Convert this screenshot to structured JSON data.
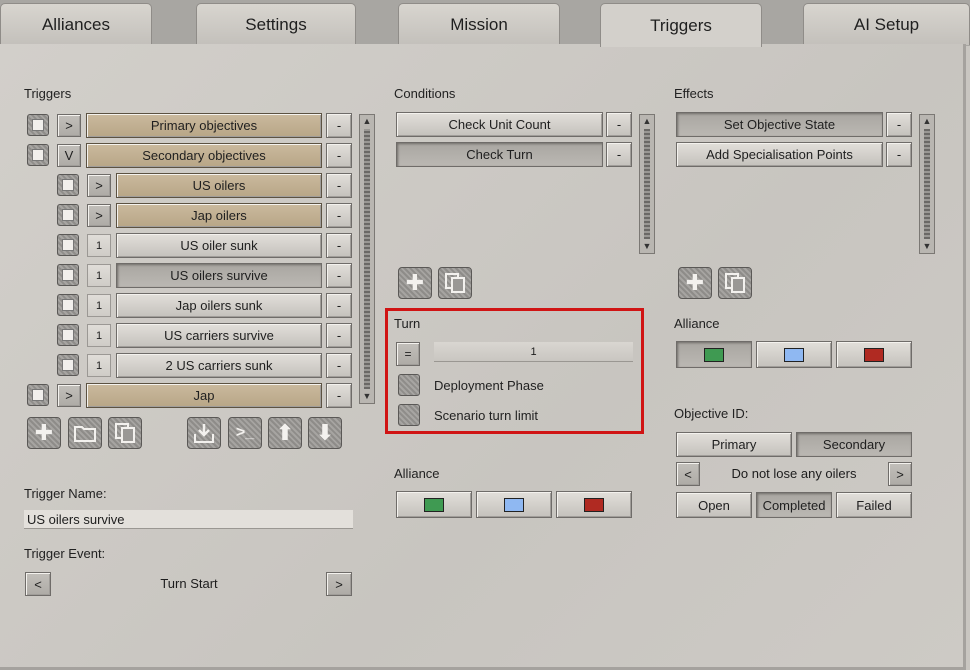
{
  "tabs": [
    {
      "label": "Alliances",
      "active": false
    },
    {
      "label": "Settings",
      "active": false
    },
    {
      "label": "Mission",
      "active": false
    },
    {
      "label": "Triggers",
      "active": true
    },
    {
      "label": "AI Setup",
      "active": false
    }
  ],
  "triggers": {
    "header": "Triggers",
    "items": [
      {
        "toggle": ">",
        "label": "Primary objectives",
        "style": "tan",
        "indent": 0
      },
      {
        "toggle": "V",
        "label": "Secondary objectives",
        "style": "tan",
        "indent": 0
      },
      {
        "toggle": ">",
        "label": "US oilers",
        "style": "tan",
        "indent": 1
      },
      {
        "toggle": ">",
        "label": "Jap oilers",
        "style": "tan",
        "indent": 1
      },
      {
        "toggle": "1",
        "label": "US oiler sunk",
        "style": "grey",
        "indent": 1
      },
      {
        "toggle": "1",
        "label": "US oilers survive",
        "style": "selected",
        "indent": 1
      },
      {
        "toggle": "1",
        "label": "Jap oilers sunk",
        "style": "grey",
        "indent": 1
      },
      {
        "toggle": "1",
        "label": "US carriers survive",
        "style": "grey",
        "indent": 1
      },
      {
        "toggle": "1",
        "label": "2 US carriers sunk",
        "style": "grey",
        "indent": 1
      },
      {
        "toggle": ">",
        "label": "Jap",
        "style": "tan",
        "indent": 0
      }
    ],
    "remove_label": "-",
    "toolbar": [
      "add-icon",
      "folder-icon",
      "copy-icon",
      "import-icon",
      "console-icon",
      "arrow-up-icon",
      "arrow-down-icon"
    ],
    "name_label": "Trigger Name:",
    "name_value": "US oilers survive",
    "event_label": "Trigger Event:",
    "event_value": "Turn Start",
    "prev": "<",
    "next": ">"
  },
  "conditions": {
    "header": "Conditions",
    "items": [
      "Check Unit Count",
      "Check Turn"
    ],
    "remove_label": "-",
    "turn": {
      "header": "Turn",
      "operator": "=",
      "value": "1",
      "options": [
        "Deployment Phase",
        "Scenario turn limit"
      ]
    },
    "alliance_label": "Alliance"
  },
  "effects": {
    "header": "Effects",
    "items": [
      "Set Objective State",
      "Add Specialisation Points"
    ],
    "remove_label": "-",
    "alliance_label": "Alliance",
    "objective_label": "Objective ID:",
    "objective_types": [
      "Primary",
      "Secondary"
    ],
    "objective_value": "Do not lose any oilers",
    "prev": "<",
    "next": ">",
    "states": [
      "Open",
      "Completed",
      "Failed"
    ]
  },
  "colors": {
    "alliance_green": "#3f9a52",
    "alliance_blue": "#8fb8f2",
    "alliance_red": "#b02a22",
    "highlight": "#d01414"
  }
}
